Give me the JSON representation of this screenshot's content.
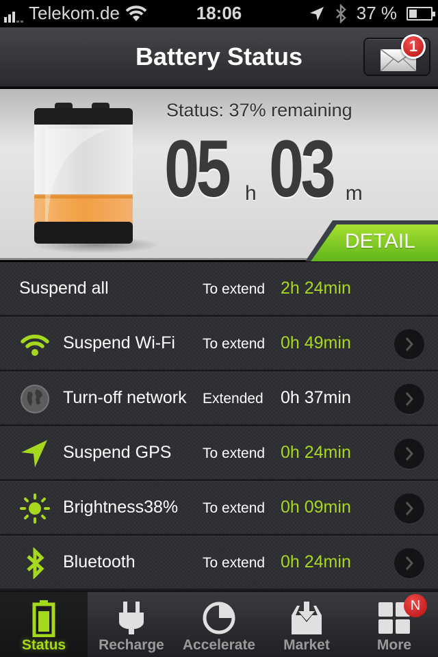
{
  "status_bar": {
    "carrier": "Telekom.de",
    "time": "18:06",
    "battery_percent": "37 %",
    "icons": [
      "signal-icon",
      "wifi-icon",
      "location-icon",
      "bluetooth-icon",
      "battery-icon"
    ]
  },
  "nav": {
    "title": "Battery Status",
    "mail_badge": "1"
  },
  "hero": {
    "status_text": "Status: 37% remaining",
    "charge_level": 0.37,
    "hours": "05",
    "hours_unit": "h",
    "minutes": "03",
    "minutes_unit": "m",
    "detail_label": "DETAIL"
  },
  "colors": {
    "accent": "#a6d81e",
    "badge": "#d41c1c"
  },
  "list": [
    {
      "title": "Suspend all",
      "prefix": "To extend",
      "value": "2h 24min",
      "icon": null,
      "highlight": true,
      "chevron": false
    },
    {
      "title": "Suspend Wi-Fi",
      "prefix": "To extend",
      "value": "0h 49min",
      "icon": "wifi-icon",
      "highlight": true,
      "chevron": true
    },
    {
      "title": "Turn-off network",
      "prefix": "Extended",
      "value": "0h 37min",
      "icon": "globe-icon",
      "highlight": false,
      "chevron": true
    },
    {
      "title": "Suspend GPS",
      "prefix": "To extend",
      "value": "0h 24min",
      "icon": "location-arrow-icon",
      "highlight": true,
      "chevron": true
    },
    {
      "title": "Brightness38%",
      "prefix": "To extend",
      "value": "0h 09min",
      "icon": "sun-icon",
      "highlight": true,
      "chevron": true
    },
    {
      "title": "Bluetooth",
      "prefix": "To extend",
      "value": "0h 24min",
      "icon": "bluetooth-icon",
      "highlight": true,
      "chevron": true
    }
  ],
  "tabs": [
    {
      "label": "Status",
      "icon": "battery-icon",
      "active": true
    },
    {
      "label": "Recharge",
      "icon": "plug-icon",
      "active": false
    },
    {
      "label": "Accelerate",
      "icon": "pie-icon",
      "active": false
    },
    {
      "label": "Market",
      "icon": "download-tray-icon",
      "active": false
    },
    {
      "label": "More",
      "icon": "grid-icon",
      "active": false,
      "badge": "N"
    }
  ]
}
